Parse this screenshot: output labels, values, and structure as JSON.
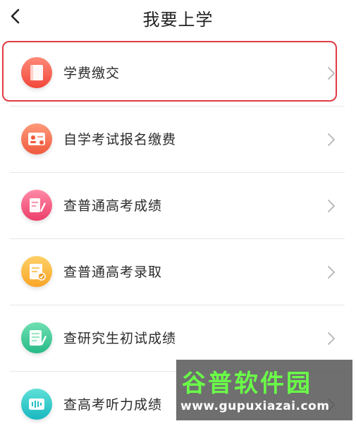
{
  "header": {
    "title": "我要上学",
    "back_icon": "chevron-left-icon"
  },
  "items": [
    {
      "label": "学费缴交",
      "icon": "book-icon",
      "color_top": "#ff8a78",
      "color_bottom": "#f1463a",
      "highlighted": true
    },
    {
      "label": "自学考试报名缴费",
      "icon": "id-card-icon",
      "color_top": "#ff9a7a",
      "color_bottom": "#ef5a3e"
    },
    {
      "label": "查普通高考成绩",
      "icon": "pen-paper-icon",
      "color_top": "#ff8aa7",
      "color_bottom": "#ec3f6a"
    },
    {
      "label": "查普通高考录取",
      "icon": "certificate-icon",
      "color_top": "#ffd067",
      "color_bottom": "#f9a526"
    },
    {
      "label": "查研究生初试成绩",
      "icon": "exam-icon",
      "color_top": "#6fe0b3",
      "color_bottom": "#27b987"
    },
    {
      "label": "查高考听力成绩",
      "icon": "audio-icon",
      "color_top": "#5fe0d8",
      "color_bottom": "#18b8c0"
    }
  ],
  "highlight_color": "#e13b44",
  "watermark": {
    "text": "谷普软件园",
    "url": "www.gupuxiazai.com"
  }
}
